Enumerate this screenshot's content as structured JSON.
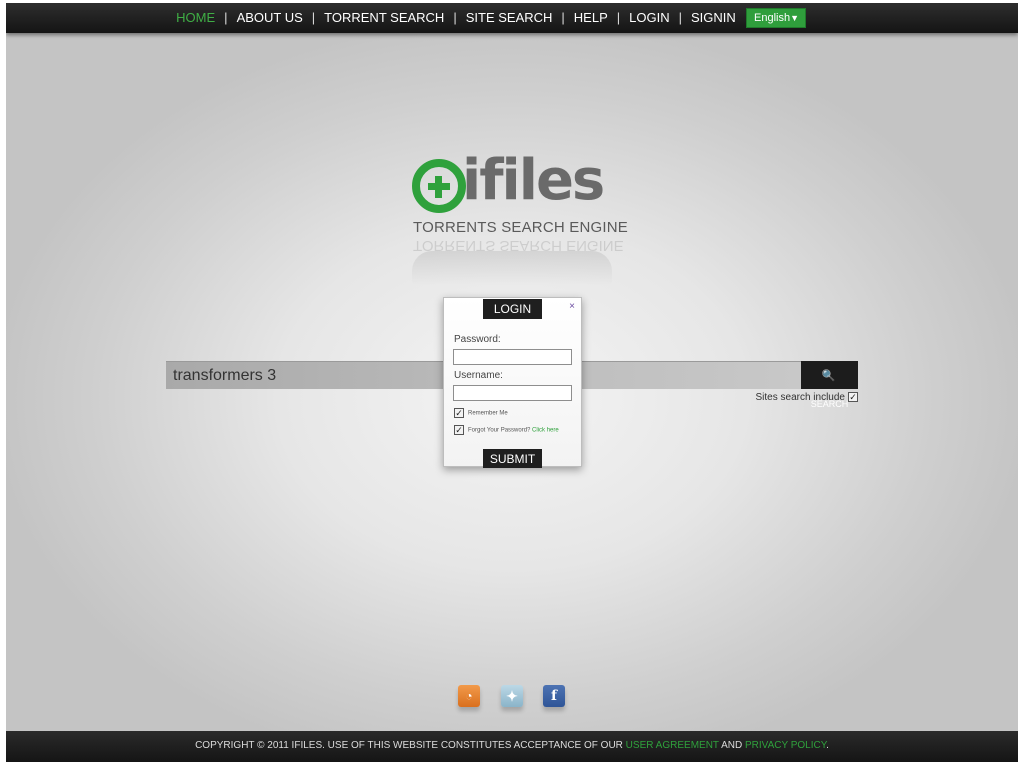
{
  "nav": {
    "items": [
      {
        "label": "HOME",
        "active": true
      },
      {
        "label": "ABOUT US",
        "active": false
      },
      {
        "label": "TORRENT SEARCH",
        "active": false
      },
      {
        "label": "SITE SEARCH",
        "active": false
      },
      {
        "label": "HELP",
        "active": false
      },
      {
        "label": "LOGIN",
        "active": false
      },
      {
        "label": "SIGNIN",
        "active": false
      }
    ],
    "separator": "|",
    "language": {
      "selected": "English",
      "caret_icon": "triangle-down-icon"
    }
  },
  "logo": {
    "name": "ifiles",
    "tagline": "TORRENTS SEARCH ENGINE",
    "mark_icon": "plus-circle-icon"
  },
  "search": {
    "value": "transformers 3",
    "button_label": "SEARCH",
    "button_icon": "magnifier-icon",
    "sites_include_label": "Sites search include",
    "sites_include_checked": true
  },
  "login_modal": {
    "title": "LOGIN",
    "close_glyph": "×",
    "password_label": "Password:",
    "username_label": "Username:",
    "remember_me_label": "Remember Me",
    "remember_me_checked": true,
    "forgot_label": "Forgot Your Password?",
    "forgot_link": "Click here",
    "forgot_checked": true,
    "submit_label": "SUBMIT"
  },
  "social": [
    {
      "name": "rss",
      "icon": "rss-icon"
    },
    {
      "name": "twitter",
      "icon": "twitter-icon"
    },
    {
      "name": "facebook",
      "icon": "facebook-icon",
      "glyph": "f"
    }
  ],
  "footer": {
    "text_before": "COPYRIGHT © 2011 IFILES. USE OF THIS WEBSITE CONSTITUTES ACCEPTANCE OF OUR ",
    "user_agreement": "USER AGREEMENT",
    "and": " AND ",
    "privacy_policy": "PRIVACY POLICY",
    "text_after": "."
  },
  "colors": {
    "accent_green": "#2fa13c",
    "dark_bar": "#1c1c1c"
  }
}
